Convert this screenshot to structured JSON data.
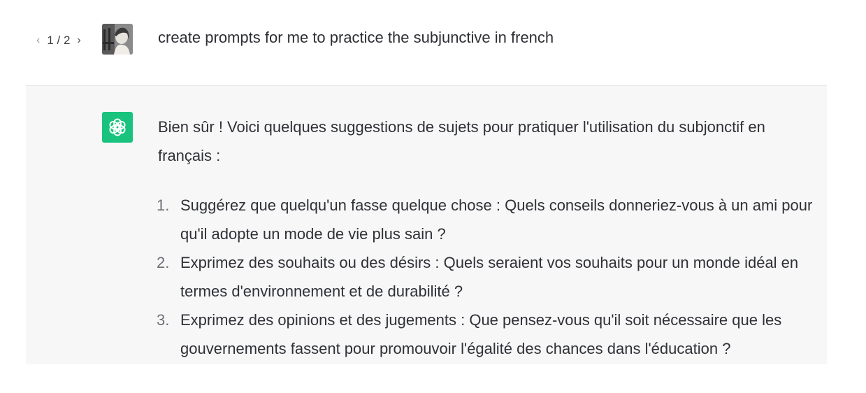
{
  "pager": {
    "prev_icon": "chevron-left-icon",
    "label": "1 / 2",
    "next_icon": "chevron-right-icon"
  },
  "user_message": {
    "avatar": "user-avatar",
    "text": "create prompts for me to practice the subjunctive in french"
  },
  "assistant_message": {
    "logo": "openai-logo-icon",
    "logo_color": "#19c37d",
    "intro": "Bien sûr ! Voici quelques suggestions de sujets pour pratiquer l'utilisation du subjonctif en français :",
    "items": [
      {
        "number": "1.",
        "text": "Suggérez que quelqu'un fasse quelque chose : Quels conseils donneriez-vous à un ami pour qu'il adopte un mode de vie plus sain ?"
      },
      {
        "number": "2.",
        "text": "Exprimez des souhaits ou des désirs : Quels seraient vos souhaits pour un monde idéal en termes d'environnement et de durabilité ?"
      },
      {
        "number": "3.",
        "text": "Exprimez des opinions et des jugements : Que pensez-vous qu'il soit nécessaire que les gouvernements fassent pour promouvoir l'égalité des chances dans l'éducation ?"
      }
    ]
  }
}
